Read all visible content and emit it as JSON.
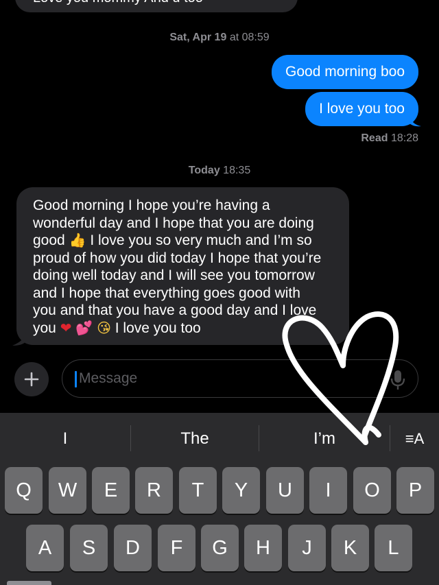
{
  "app": "Messages",
  "cutoff_message": {
    "text": "Love you mommy        And          u too"
  },
  "timestamps": [
    {
      "day": "Sat, Apr 19",
      "time": "at 08:59"
    },
    {
      "day": "Today",
      "time": "18:35"
    }
  ],
  "outgoing": [
    {
      "text": "Good morning boo"
    },
    {
      "text": "I love you too"
    }
  ],
  "read_receipt": {
    "label": "Read",
    "time": "18:28"
  },
  "incoming": {
    "lines": [
      "Good morning I hope you’re having a",
      "wonderful day and I hope that you are doing",
      "good",
      "I love you so very much and I’m so",
      "proud of how you did today I hope that you’re",
      "doing well today and I will see you tomorrow",
      "and I hope that everything goes good with",
      "you and that you have a good day and I love",
      "you",
      "I love you too"
    ],
    "emojis": {
      "thumb": "👍",
      "heart": "❤",
      "hearts": "💕",
      "kiss": "😘"
    }
  },
  "composer": {
    "placeholder": "Message",
    "plus_icon": "plus-icon",
    "mic_icon": "mic-icon"
  },
  "keyboard": {
    "suggestions": [
      "I",
      "The",
      "I’m"
    ],
    "format_key": "≡A",
    "row1": [
      "Q",
      "W",
      "E",
      "R",
      "T",
      "Y",
      "U",
      "I",
      "O",
      "P"
    ],
    "row2": [
      "A",
      "S",
      "D",
      "F",
      "G",
      "H",
      "J",
      "K",
      "L"
    ]
  },
  "colors": {
    "blue_bubble": "#0b84fe",
    "gray_bubble": "#262629",
    "background": "#000000",
    "keyboard": "#2b2b2d",
    "key": "#6c6c6e"
  }
}
